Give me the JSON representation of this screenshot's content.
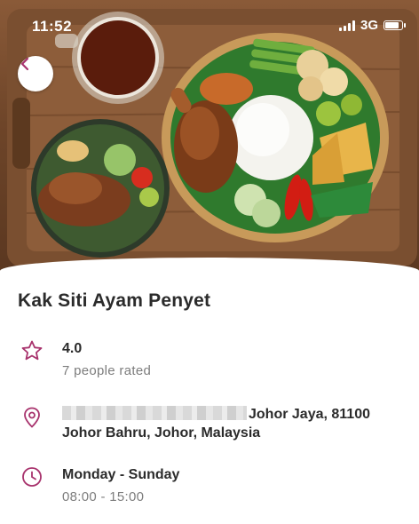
{
  "status_bar": {
    "time": "11:52",
    "network": "3G",
    "icons": [
      "signal-bars-icon",
      "battery-icon"
    ]
  },
  "navigation": {
    "back_icon": "chevron-left-icon"
  },
  "hero": {
    "image": "photo of nasi ayam penyet platter with fried chicken, rice, tempeh, tofu and a glass of tea on a wooden tray"
  },
  "restaurant": {
    "name": "Kak Siti Ayam Penyet"
  },
  "rating": {
    "icon": "star-outline-icon",
    "value": "4.0",
    "count_text": "7 people rated"
  },
  "address": {
    "icon": "location-pin-icon",
    "line1": "Johor Jaya, 81100",
    "line2": "Johor Bahru, Johor, Malaysia"
  },
  "hours": {
    "icon": "clock-icon",
    "days": "Monday - Sunday",
    "time": "08:00 - 15:00"
  },
  "colors": {
    "accent": "#a8336d",
    "text_primary": "#2b2b2b",
    "text_secondary": "#7d7d7d"
  }
}
